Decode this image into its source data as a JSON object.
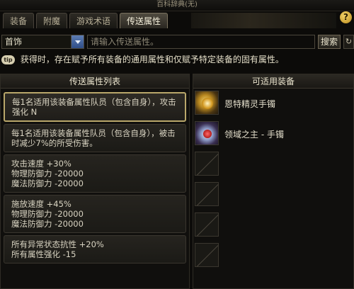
{
  "window": {
    "title": "百科辞典(无)"
  },
  "tabs": [
    {
      "label": "装备",
      "active": false
    },
    {
      "label": "附魔",
      "active": false
    },
    {
      "label": "游戏术语",
      "active": false
    },
    {
      "label": "传送属性",
      "active": true
    }
  ],
  "help_label": "?",
  "filter": {
    "category_value": "首饰",
    "search_placeholder": "请输入传送属性。",
    "search_button": "搜索",
    "refresh_label": "↻"
  },
  "notice": {
    "badge": "tip",
    "text": "获得时，存在赋予所有装备的通用属性和仅赋予特定装备的固有属性。"
  },
  "attribute_panel": {
    "header": "传送属性列表",
    "items": [
      {
        "lines": [
          "每1名适用该装备属性队员（包含自身），攻击强化 N"
        ],
        "selected": true
      },
      {
        "lines": [
          "每1名适用该装备属性队员（包含自身），被击时减少7%的所受伤害。"
        ],
        "selected": false
      },
      {
        "lines": [
          "攻击速度 +30%",
          "物理防御力 -20000",
          "魔法防御力 -20000"
        ],
        "selected": false
      },
      {
        "lines": [
          "施放速度 +45%",
          "物理防御力 -20000",
          "魔法防御力 -20000"
        ],
        "selected": false
      },
      {
        "lines": [
          "所有异常状态抗性 +20%",
          "所有属性强化 -15"
        ],
        "selected": false
      }
    ]
  },
  "equipment_panel": {
    "header": "可适用装备",
    "items": [
      {
        "name": "恩特精灵手镯",
        "icon": "golden-bracelet-icon"
      },
      {
        "name": "领域之主 - 手镯",
        "icon": "domain-lord-bracelet-icon"
      },
      {
        "name": "",
        "icon": "empty-slot-icon"
      },
      {
        "name": "",
        "icon": "empty-slot-icon"
      },
      {
        "name": "",
        "icon": "empty-slot-icon"
      },
      {
        "name": "",
        "icon": "empty-slot-icon"
      }
    ]
  },
  "colors": {
    "accent_gold": "#b9a76a",
    "active_tab": "#4f4a3f",
    "search_button": "#3e3a31"
  }
}
